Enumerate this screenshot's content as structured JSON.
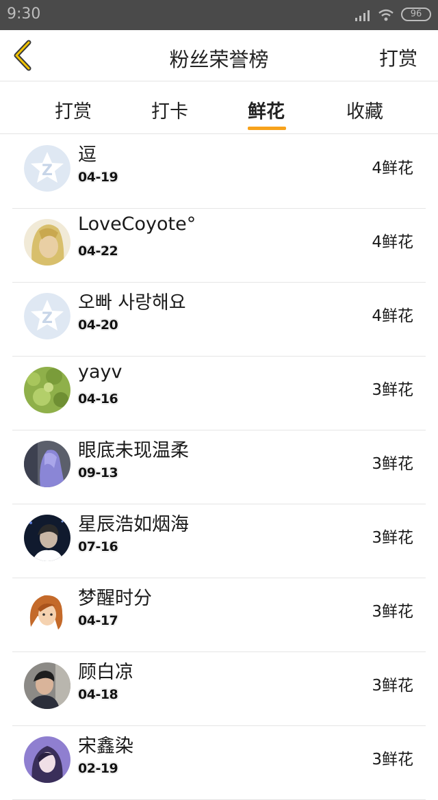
{
  "status_bar": {
    "time": "9:30",
    "battery": "96"
  },
  "header": {
    "title": "粉丝荣誉榜",
    "action_label": "打赏"
  },
  "tabs": [
    {
      "label": "打赏",
      "active": false
    },
    {
      "label": "打卡",
      "active": false
    },
    {
      "label": "鲜花",
      "active": true
    },
    {
      "label": "收藏",
      "active": false
    }
  ],
  "accent_color": "#f7a21b",
  "fans": [
    {
      "name": "逗",
      "date": "04-19",
      "count": "4鲜花",
      "avatar": "qq-default-avatar"
    },
    {
      "name": "LoveCoyote°",
      "date": "04-22",
      "count": "4鲜花",
      "avatar": "blonde-character-avatar"
    },
    {
      "name": "오빠 사랑해요",
      "date": "04-20",
      "count": "4鲜花",
      "avatar": "qq-default-avatar"
    },
    {
      "name": "yayv",
      "date": "04-16",
      "count": "3鲜花",
      "avatar": "green-foliage-avatar"
    },
    {
      "name": "眼底未现温柔",
      "date": "09-13",
      "count": "3鲜花",
      "avatar": "purple-hair-avatar"
    },
    {
      "name": "星辰浩如烟海",
      "date": "07-16",
      "count": "3鲜花",
      "avatar": "dark-portrait-avatar"
    },
    {
      "name": "梦醒时分",
      "date": "04-17",
      "count": "3鲜花",
      "avatar": "cartoon-girl-avatar"
    },
    {
      "name": "顾白凉",
      "date": "04-18",
      "count": "3鲜花",
      "avatar": "boy-photo-avatar"
    },
    {
      "name": "宋鑫染",
      "date": "02-19",
      "count": "3鲜花",
      "avatar": "girl-portrait-avatar"
    }
  ]
}
